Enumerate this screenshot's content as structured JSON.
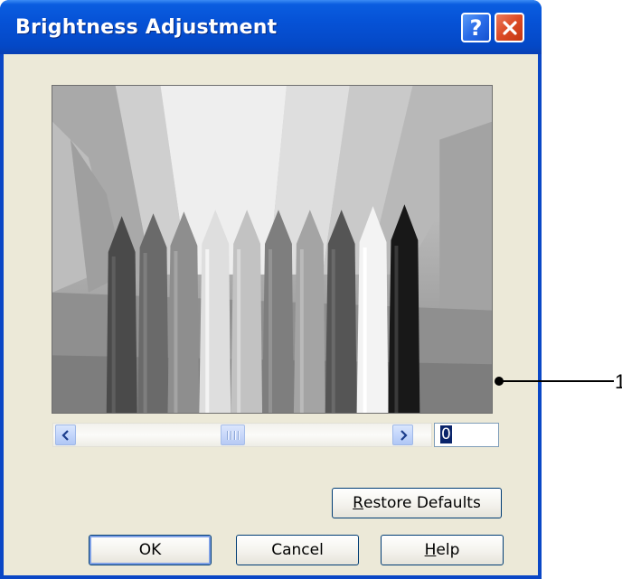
{
  "window": {
    "title": "Brightness Adjustment",
    "help_caption": "?"
  },
  "preview": {
    "description_icon": "image-preview",
    "crayon_shades": [
      "#5a5a5a",
      "#7a7a7a",
      "#9a9a9a",
      "#dcdcdc",
      "#c4c4c4",
      "#8c8c8c",
      "#a6a6a6",
      "#5e5e5e",
      "#efefef",
      "#1c1c1c"
    ]
  },
  "slider": {
    "value": "0",
    "thumb_position_fraction": 0.5
  },
  "buttons": {
    "restore_prefix": "",
    "restore_mnemonic": "R",
    "restore_rest": "estore Defaults",
    "ok": "OK",
    "cancel": "Cancel",
    "help_mnemonic": "H",
    "help_rest": "elp"
  },
  "callout": {
    "number": "1"
  },
  "colors": {
    "titlebar": "#0a5de0",
    "client_background": "#ece9d8",
    "close_button": "#db4a25",
    "button_border": "#003c74"
  }
}
